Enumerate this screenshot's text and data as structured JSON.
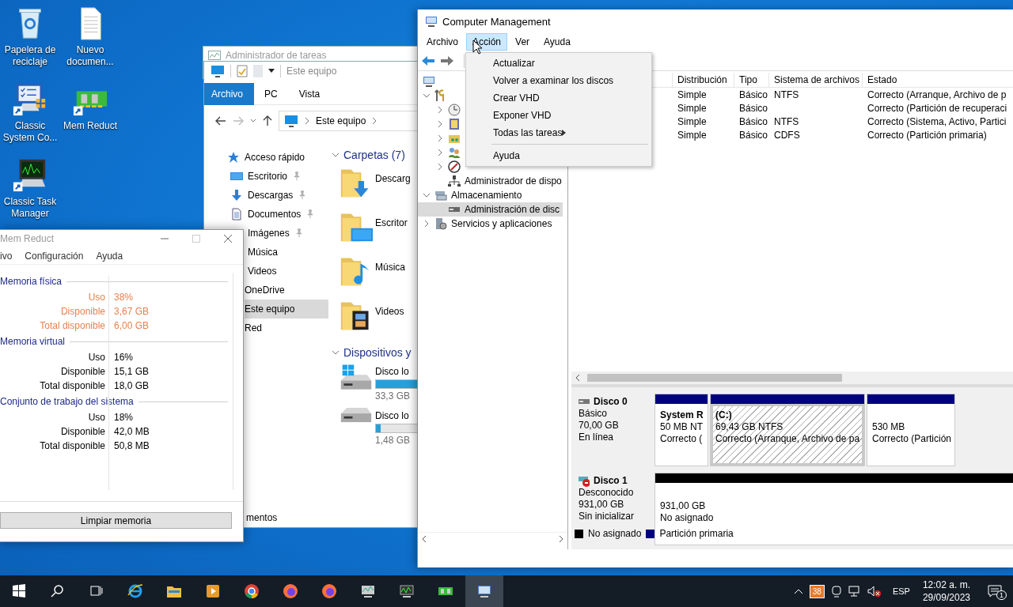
{
  "desktop": {
    "icons": [
      {
        "label": "Papelera de reciclaje",
        "kind": "recycle",
        "shortcut": false
      },
      {
        "label": "Nuevo documen...",
        "kind": "document",
        "shortcut": false
      },
      {
        "label": "Classic System Co...",
        "kind": "control",
        "shortcut": true
      },
      {
        "label": "Mem Reduct",
        "kind": "ram",
        "shortcut": true
      },
      {
        "label": "Classic Task Manager",
        "kind": "taskmgr",
        "shortcut": true
      }
    ]
  },
  "task_manager_window": {
    "title": "Administrador de tareas"
  },
  "explorer": {
    "toolbar_title": "Este equipo",
    "tabs": [
      {
        "label": "Archivo",
        "selected": true
      },
      {
        "label": "PC",
        "selected": false
      },
      {
        "label": "Vista",
        "selected": false
      }
    ],
    "address": "Este equipo",
    "nav": [
      {
        "label": "Acceso rápido",
        "kind": "star",
        "selected": false,
        "children": [
          {
            "label": "Escritorio",
            "kind": "desktop",
            "pinned": true,
            "selected": false
          },
          {
            "label": "Descargas",
            "kind": "download",
            "pinned": true,
            "selected": false
          },
          {
            "label": "Documentos",
            "kind": "documents",
            "pinned": true,
            "selected": false
          },
          {
            "label": "Imágenes",
            "kind": "pictures",
            "pinned": true,
            "selected": false
          },
          {
            "label": "Música",
            "kind": "music",
            "pinned": false,
            "selected": false
          },
          {
            "label": "Videos",
            "kind": "videos",
            "pinned": false,
            "selected": false
          }
        ]
      },
      {
        "label": "OneDrive",
        "kind": "cloud",
        "selected": false
      },
      {
        "label": "Este equipo",
        "kind": "pc",
        "selected": true
      },
      {
        "label": "Red",
        "kind": "network",
        "selected": false
      }
    ],
    "sections": [
      {
        "title": "Carpetas (7)",
        "expanded": true,
        "items": [
          {
            "label": "Descarg",
            "kind": "downloads"
          },
          {
            "label": "Escritor",
            "kind": "desktop"
          },
          {
            "label": "Música",
            "kind": "music"
          },
          {
            "label": "Videos",
            "kind": "videos"
          }
        ]
      },
      {
        "title": "Dispositivos y",
        "expanded": true,
        "items": [
          {
            "label": "Disco lo",
            "kind": "system-drive",
            "level": 0.52,
            "reading": "33,3 GB"
          },
          {
            "label": "Disco lo",
            "kind": "drive",
            "level": 0.03,
            "reading": "1,48 GB"
          }
        ]
      }
    ],
    "status": "mentos"
  },
  "mem_reduct": {
    "title": "Mem Reduct",
    "menu": [
      "ivo",
      "Configuración",
      "Ayuda"
    ],
    "groups": [
      {
        "title": "Memoria física",
        "highlighted": true,
        "rows": [
          {
            "label": "Uso",
            "value": "38%"
          },
          {
            "label": "Disponible",
            "value": "3,67 GB"
          },
          {
            "label": "Total disponible",
            "value": "6,00 GB"
          }
        ]
      },
      {
        "title": "Memoria virtual",
        "highlighted": false,
        "rows": [
          {
            "label": "Uso",
            "value": "16%"
          },
          {
            "label": "Disponible",
            "value": "15,1 GB"
          },
          {
            "label": "Total disponible",
            "value": "18,0 GB"
          }
        ]
      },
      {
        "title": "Conjunto de trabajo del sistema",
        "highlighted": false,
        "rows": [
          {
            "label": "Uso",
            "value": "18%"
          },
          {
            "label": "Disponible",
            "value": "42,0 MB"
          },
          {
            "label": "Total disponible",
            "value": "50,8 MB"
          }
        ]
      }
    ],
    "button": "Limpiar memoria"
  },
  "computer_management": {
    "title": "Computer Management",
    "menu": [
      {
        "label": "Archivo",
        "selected": false
      },
      {
        "label": "Acción",
        "selected": true
      },
      {
        "label": "Ver",
        "selected": false
      },
      {
        "label": "Ayuda",
        "selected": false
      }
    ],
    "dropdown": [
      {
        "label": "Actualizar",
        "kind": "item"
      },
      {
        "label": "Volver a examinar los discos",
        "kind": "item"
      },
      {
        "label": "Crear VHD",
        "kind": "item"
      },
      {
        "label": "Exponer VHD",
        "kind": "item"
      },
      {
        "label": "Todas las tareas",
        "kind": "submenu"
      },
      {
        "kind": "separator"
      },
      {
        "label": "Ayuda",
        "kind": "item"
      }
    ],
    "tree": [
      {
        "kind": "computer",
        "selected": false,
        "children": [
          {
            "kind": "tools",
            "expanded": true,
            "selected": false,
            "children": [
              {
                "kind": "clock",
                "expanded": false,
                "selected": false
              },
              {
                "kind": "eventlog",
                "expanded": false,
                "selected": false
              },
              {
                "kind": "share",
                "expanded": false,
                "selected": false
              },
              {
                "kind": "users",
                "expanded": false,
                "selected": false
              },
              {
                "kind": "perf",
                "expanded": false,
                "selected": false
              },
              {
                "kind": "devices",
                "label": "Administrador de dispo",
                "selected": false
              }
            ]
          },
          {
            "kind": "storage",
            "label": "Almacenamiento",
            "expanded": true,
            "selected": false,
            "children": [
              {
                "kind": "disk",
                "label": "Administración de disc",
                "selected": true
              }
            ]
          },
          {
            "kind": "services",
            "label": "Servicios y aplicaciones",
            "expanded": false,
            "selected": false
          }
        ]
      }
    ],
    "columns": [
      "Distribución",
      "Tipo",
      "Sistema de archivos",
      "Estado"
    ],
    "volumes": [
      {
        "layout": "Simple",
        "type": "Básico",
        "fs": "NTFS",
        "status": "Correcto (Arranque, Archivo de p"
      },
      {
        "layout": "Simple",
        "type": "Básico",
        "status": "Correcto (Partición de recuperaci"
      },
      {
        "layout": "Simple",
        "type": "Básico",
        "fs": "NTFS",
        "status": "Correcto (Sistema, Activo, Partici"
      },
      {
        "layout": "Simple",
        "type": "Básico",
        "fs": "CDFS",
        "status": "Correcto (Partición primaria)"
      }
    ],
    "disks": [
      {
        "name": "Disco 0",
        "kind": "online",
        "lines": [
          "Básico",
          "70,00 GB",
          "En línea"
        ],
        "partitions": [
          {
            "name": "System R",
            "lines": [
              "50 MB NT",
              "Correcto ("
            ],
            "color": "#000080",
            "selected": false
          },
          {
            "name": "(C:)",
            "lines": [
              "69,43 GB NTFS",
              "Correcto (Arranque, Archivo de pa"
            ],
            "color": "#000080",
            "selected": true
          },
          {
            "lines": [
              "530 MB",
              "Correcto (Partición"
            ],
            "color": "#000080",
            "selected": false
          }
        ]
      },
      {
        "name": "Disco 1",
        "kind": "error",
        "lines": [
          "Desconocido",
          "931,00 GB",
          "Sin inicializar"
        ],
        "partitions": [
          {
            "lines": [
              "931,00 GB",
              "No asignado"
            ],
            "color": "#000000",
            "selected": false
          }
        ]
      }
    ],
    "legend": [
      {
        "label": "No asignado",
        "color": "#000000"
      },
      {
        "label": "Partición primaria",
        "color": "#000080"
      }
    ]
  },
  "taskbar": {
    "apps": [
      {
        "kind": "start",
        "active": false
      },
      {
        "kind": "search",
        "active": false
      },
      {
        "kind": "task-view",
        "active": false
      },
      {
        "kind": "ie",
        "active": false
      },
      {
        "kind": "explorer",
        "active": false
      },
      {
        "kind": "media",
        "active": false
      },
      {
        "kind": "chrome",
        "active": false
      },
      {
        "kind": "firefox",
        "active": false
      },
      {
        "kind": "firefox",
        "active": false
      },
      {
        "kind": "sysmon",
        "active": false
      },
      {
        "kind": "taskmgr",
        "active": false
      },
      {
        "kind": "ram",
        "active": false
      },
      {
        "kind": "compmgmt",
        "active": true
      }
    ],
    "badge": "38",
    "language": "ESP",
    "time": "12:02 a. m.",
    "date": "29/09/2023",
    "notifications": "1"
  }
}
